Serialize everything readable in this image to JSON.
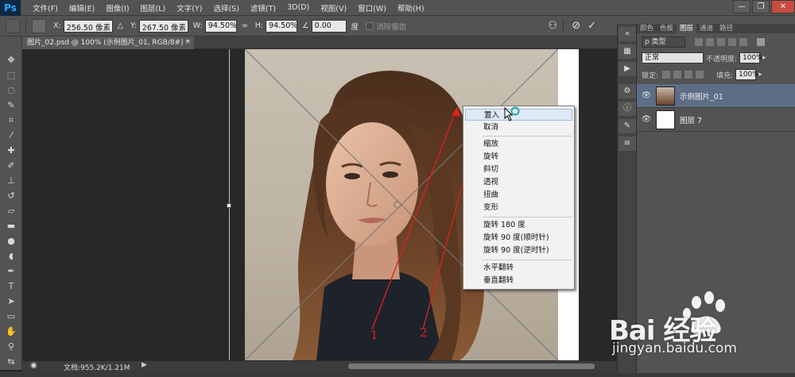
{
  "app": {
    "logo": "Ps",
    "menu": [
      "文件(F)",
      "编辑(E)",
      "图像(I)",
      "图层(L)",
      "文字(Y)",
      "选择(S)",
      "滤镜(T)",
      "3D(D)",
      "视图(V)",
      "窗口(W)",
      "帮助(H)"
    ],
    "window_controls": [
      "—",
      "❐",
      "✕"
    ]
  },
  "options_bar": {
    "x_label": "X:",
    "x_value": "256.50 像素",
    "y_label": "Y:",
    "y_value": "267.50 像素",
    "w_label": "W:",
    "w_value": "94.50%",
    "h_label": "H:",
    "h_value": "94.50%",
    "angle_value": "0.00",
    "angle_unit": "度",
    "antialias_label": "消除锯齿"
  },
  "document": {
    "tab_label": "图片_02.psd @ 100% (示例图片_01, RGB/8#) *",
    "tab_close": "×",
    "status": "文档:955.2K/1.21M"
  },
  "context_menu": {
    "items": [
      "置入",
      "取消",
      "缩放",
      "旋转",
      "斜切",
      "透视",
      "扭曲",
      "变形",
      "旋转 180 度",
      "旋转 90 度(顺时针)",
      "旋转 90 度(逆时针)",
      "水平翻转",
      "垂直翻转"
    ],
    "highlighted": "置入"
  },
  "annotations": {
    "label_1": "1",
    "label_2": "2",
    "color": "#e02020"
  },
  "panel": {
    "tabs": [
      "颜色",
      "色板",
      "图层",
      "通道",
      "路径"
    ],
    "active_tab": "图层",
    "filter_label": "ρ 类型",
    "blend_mode": "正常",
    "opacity_label": "不透明度:",
    "opacity_value": "100%",
    "lock_label": "锁定:",
    "fill_label": "填充:",
    "fill_value": "100%",
    "layers": [
      {
        "name": "示例图片_01",
        "selected": true
      },
      {
        "name": "图层 7",
        "selected": false
      }
    ]
  },
  "watermark": {
    "text": "Bai 经验",
    "url": "jingyan.baidu.com"
  }
}
